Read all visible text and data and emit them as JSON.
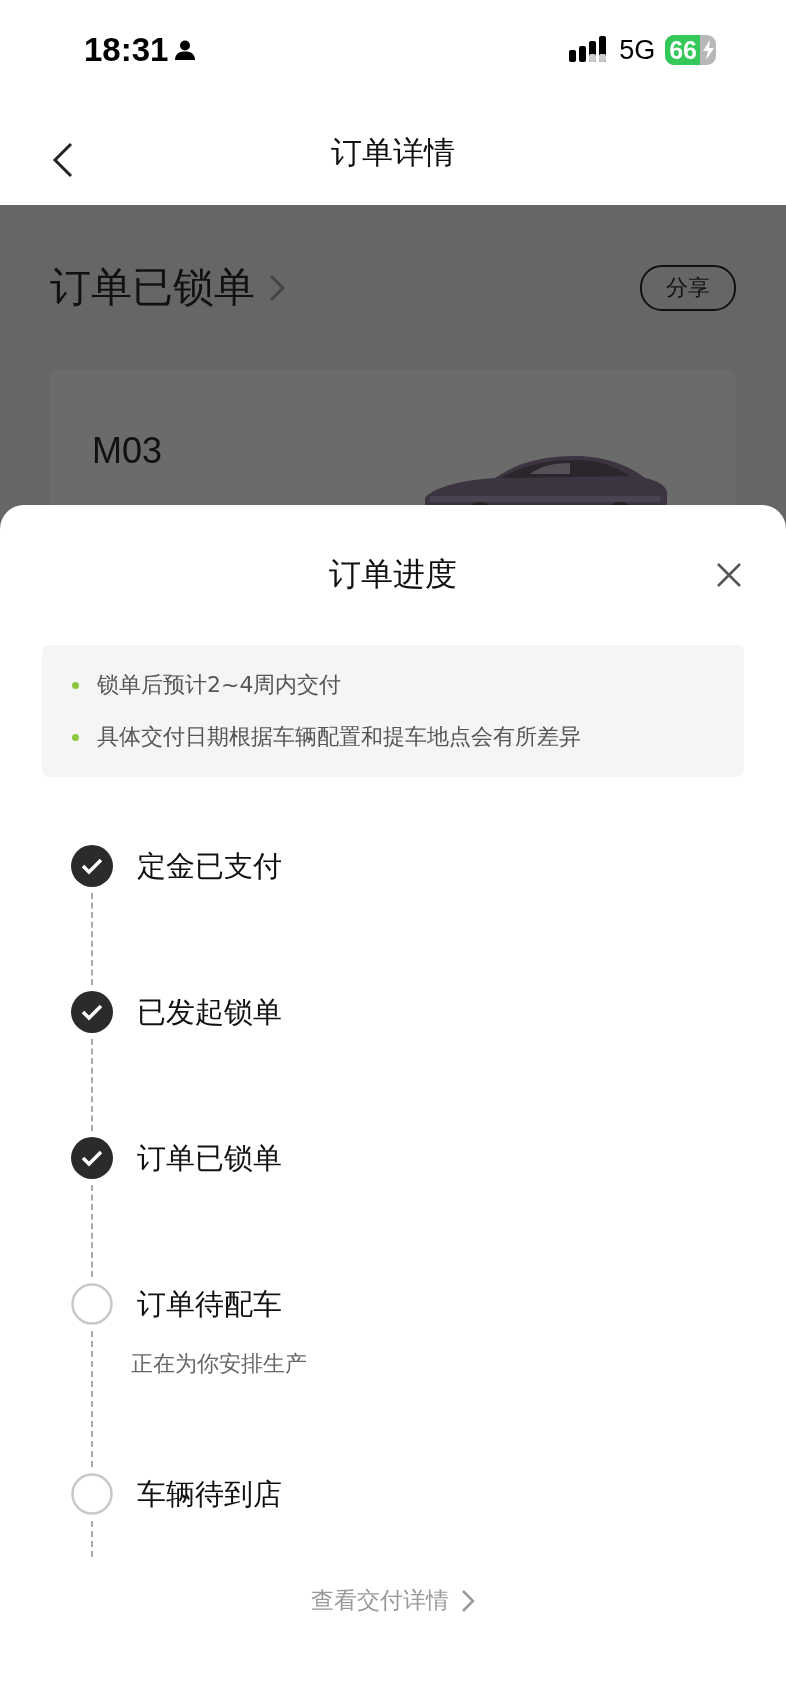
{
  "status_bar": {
    "time": "18:31",
    "network": "5G",
    "battery": "66"
  },
  "nav": {
    "title": "订单详情"
  },
  "order": {
    "status": "订单已锁单",
    "share": "分享",
    "model": "M03"
  },
  "sheet": {
    "title": "订单进度",
    "notes": [
      "锁单后预计2~4周内交付",
      "具体交付日期根据车辆配置和提车地点会有所差异"
    ],
    "steps": [
      {
        "label": "定金已支付",
        "done": true
      },
      {
        "label": "已发起锁单",
        "done": true
      },
      {
        "label": "订单已锁单",
        "done": true
      },
      {
        "label": "订单待配车",
        "done": false,
        "note": "正在为你安排生产"
      },
      {
        "label": "车辆待到店",
        "done": false
      }
    ],
    "link": "查看交付详情"
  }
}
